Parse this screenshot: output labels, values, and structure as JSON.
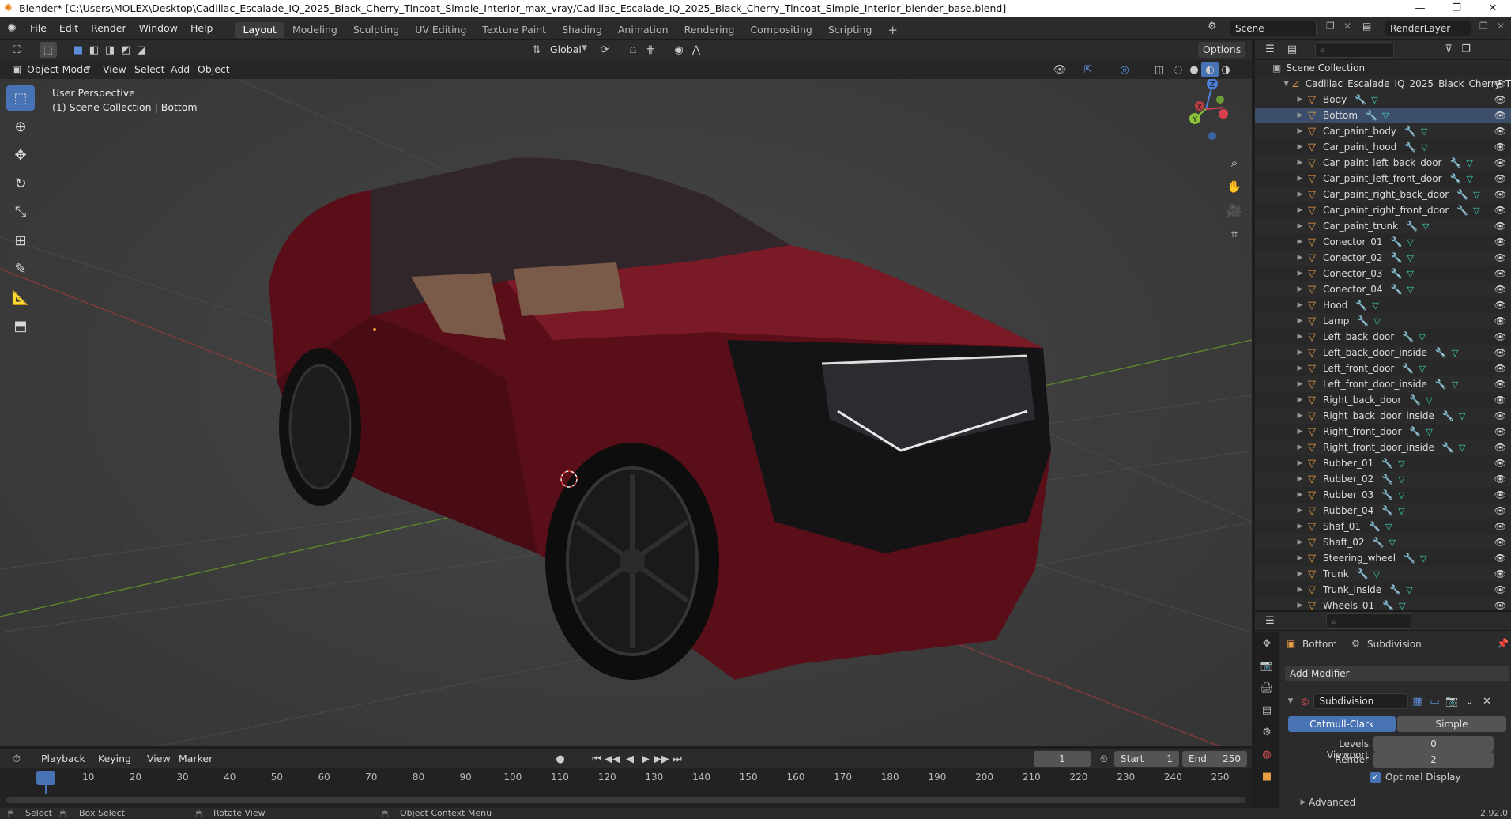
{
  "window": {
    "title": "Blender* [C:\\Users\\MOLEX\\Desktop\\Cadillac_Escalade_IQ_2025_Black_Cherry_Tincoat_Simple_Interior_max_vray/Cadillac_Escalade_IQ_2025_Black_Cherry_Tincoat_Simple_Interior_blender_base.blend]",
    "minimize": "—",
    "maximize": "❐",
    "close": "✕"
  },
  "menu": [
    "File",
    "Edit",
    "Render",
    "Window",
    "Help"
  ],
  "workspaces": [
    "Layout",
    "Modeling",
    "Sculpting",
    "UV Editing",
    "Texture Paint",
    "Shading",
    "Animation",
    "Rendering",
    "Compositing",
    "Scripting"
  ],
  "active_workspace": "Layout",
  "scene": "Scene",
  "render_layer": "RenderLayer",
  "viewport_header": {
    "transform_orientation": "Global",
    "options": "Options",
    "mode": "Object Mode",
    "menus": [
      "View",
      "Select",
      "Add",
      "Object"
    ]
  },
  "viewport": {
    "perspective": "User Perspective",
    "collection_info": "(1) Scene Collection | Bottom",
    "gizmo": {
      "z": "Z",
      "y": "Y",
      "x": "X"
    }
  },
  "outliner": {
    "root": "Scene Collection",
    "collection": "Cadillac_Escalade_IQ_2025_Black_Cherry_T",
    "objects": [
      "Body",
      "Bottom",
      "Car_paint_body",
      "Car_paint_hood",
      "Car_paint_left_back_door",
      "Car_paint_left_front_door",
      "Car_paint_right_back_door",
      "Car_paint_right_front_door",
      "Car_paint_trunk",
      "Conector_01",
      "Conector_02",
      "Conector_03",
      "Conector_04",
      "Hood",
      "Lamp",
      "Left_back_door",
      "Left_back_door_inside",
      "Left_front_door",
      "Left_front_door_inside",
      "Right_back_door",
      "Right_back_door_inside",
      "Right_front_door",
      "Right_front_door_inside",
      "Rubber_01",
      "Rubber_02",
      "Rubber_03",
      "Rubber_04",
      "Shaf_01",
      "Shaft_02",
      "Steering_wheel",
      "Trunk",
      "Trunk_inside",
      "Wheels_01"
    ],
    "selected": "Bottom"
  },
  "properties": {
    "object": "Bottom",
    "modifier_context": "Subdivision",
    "add_modifier": "Add Modifier",
    "modifier_name": "Subdivision",
    "catmull": "Catmull-Clark",
    "simple": "Simple",
    "levels_viewport_label": "Levels Viewport",
    "levels_viewport": "0",
    "render_label": "Render",
    "render": "2",
    "optimal_display": "Optimal Display",
    "advanced": "Advanced"
  },
  "timeline": {
    "menus": [
      "Playback",
      "Keying",
      "View",
      "Marker"
    ],
    "current_frame": "1",
    "start_label": "Start",
    "start": "1",
    "end_label": "End",
    "end": "250",
    "ticks": [
      "1",
      "10",
      "20",
      "30",
      "40",
      "50",
      "60",
      "70",
      "80",
      "90",
      "100",
      "110",
      "120",
      "130",
      "140",
      "150",
      "160",
      "170",
      "180",
      "190",
      "200",
      "210",
      "220",
      "230",
      "240",
      "250"
    ]
  },
  "statusbar": {
    "select": "Select",
    "box_select": "Box Select",
    "rotate": "Rotate View",
    "context": "Object Context Menu",
    "version": "2.92.0"
  },
  "colors": {
    "accent": "#4772b3",
    "object_icon": "#e89d45",
    "mesh_icon": "#3dd6b8",
    "car_paint": "#6b0d18"
  }
}
